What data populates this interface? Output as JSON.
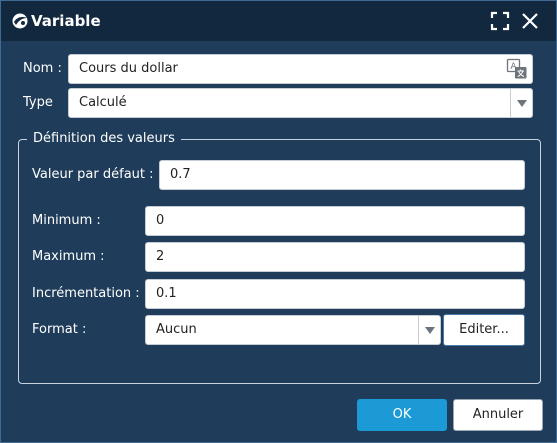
{
  "window": {
    "title": "Variable",
    "icons": {
      "app": "ray-logo-icon",
      "maximize": "maximize-icon",
      "close": "close-icon"
    }
  },
  "form": {
    "name_label": "Nom :",
    "name_value": "Cours du dollar",
    "translate_icon": "translate-icon",
    "type_label": "Type",
    "type_value": "Calculé"
  },
  "values_group": {
    "legend": "Définition des valeurs",
    "default_label": "Valeur par défaut :",
    "default_value": "0.7",
    "min_label": "Minimum :",
    "min_value": "0",
    "max_label": "Maximum :",
    "max_value": "2",
    "step_label": "Incrémentation :",
    "step_value": "0.1",
    "format_label": "Format :",
    "format_value": "Aucun",
    "edit_label": "Editer..."
  },
  "footer": {
    "ok_label": "OK",
    "cancel_label": "Annuler"
  },
  "colors": {
    "background": "#1f3d5a",
    "titlebar": "#12283e",
    "primary_button": "#1b9ad6"
  }
}
